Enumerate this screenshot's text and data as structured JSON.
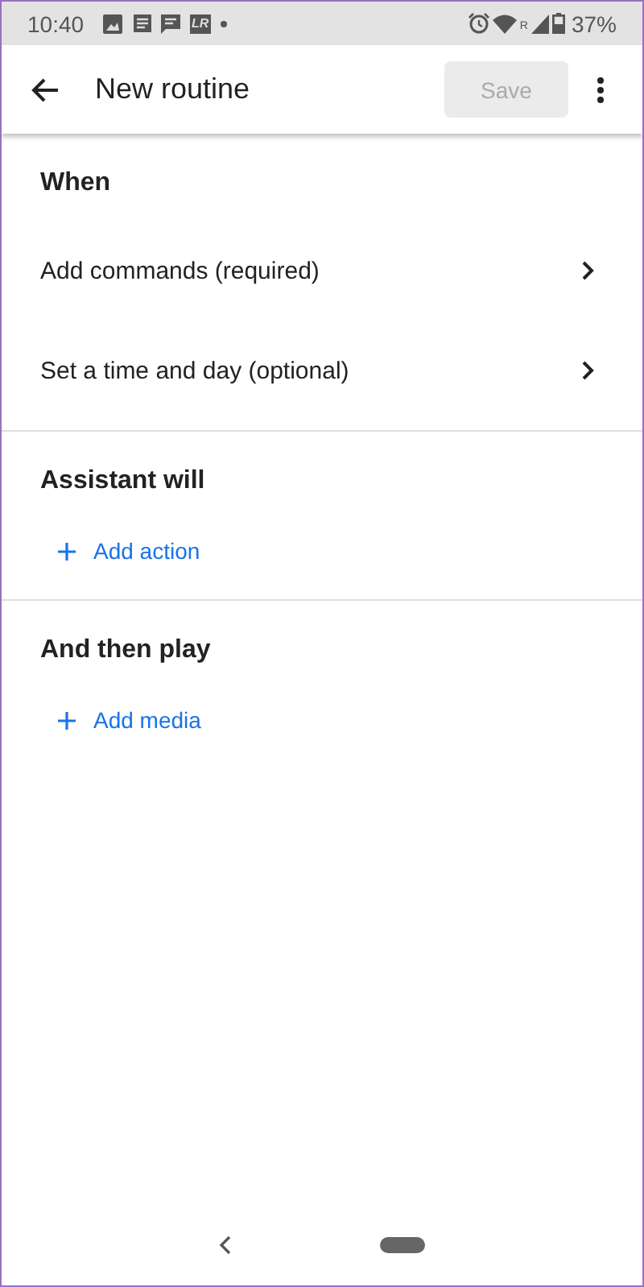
{
  "status_bar": {
    "time": "10:40",
    "app_badge": "LR",
    "roaming": "R",
    "battery": "37%"
  },
  "app_bar": {
    "title": "New routine",
    "save": {
      "label": "Save",
      "disabled": true
    }
  },
  "sections": [
    {
      "heading": "When",
      "items": [
        {
          "kind": "nav",
          "label": "Add commands (required)"
        },
        {
          "kind": "nav",
          "label": "Set a time and day (optional)"
        }
      ]
    },
    {
      "heading": "Assistant will",
      "items": [
        {
          "kind": "add",
          "label": "Add action"
        }
      ]
    },
    {
      "heading": "And then play",
      "items": [
        {
          "kind": "add",
          "label": "Add media"
        }
      ]
    }
  ]
}
